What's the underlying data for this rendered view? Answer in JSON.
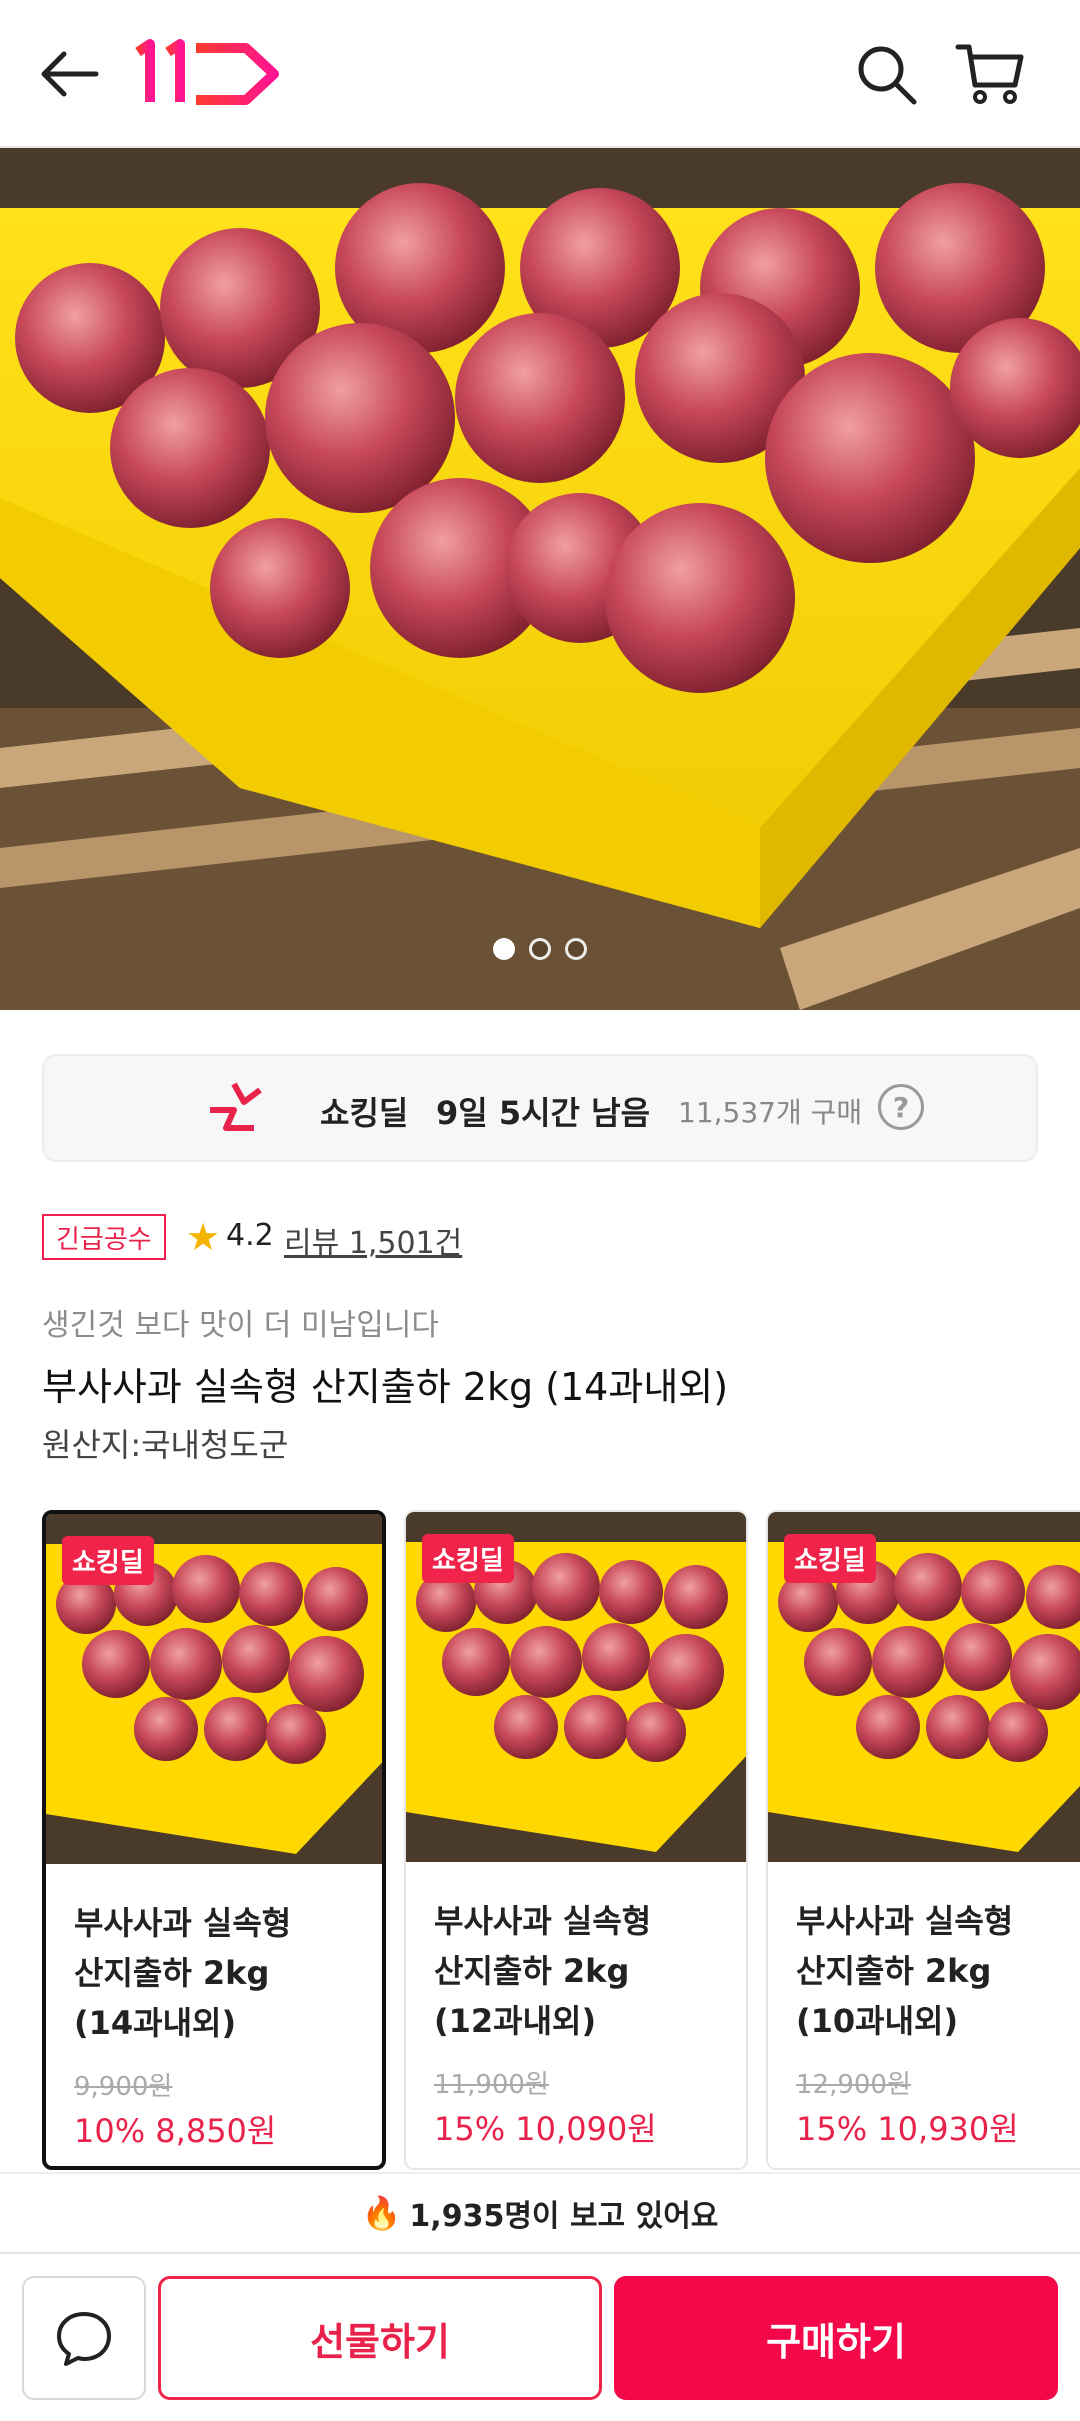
{
  "header": {
    "logo_text": "11",
    "brand_color": "#f0224d"
  },
  "hero": {
    "slide_count": 3,
    "active_slide": 1
  },
  "deal": {
    "brand": "쇼킹딜",
    "time_left": "9일 5시간 남음",
    "purchase_count": "11,537개 구매",
    "help": "?"
  },
  "badge": "긴급공수",
  "rating": {
    "star": "★",
    "value": "4.2",
    "review_label": "리뷰 1,501건"
  },
  "product": {
    "subtitle": "생긴것 보다 맛이 더 미남입니다",
    "title": "부사사과 실속형 산지출하 2kg (14과내외)",
    "origin": "원산지:국내청도군"
  },
  "options": [
    {
      "tag": "쇼킹딜",
      "name_lines": [
        "부사사과 실속형",
        "산지출하 2kg",
        "(14과내외)"
      ],
      "original_price": "9,900원",
      "price": "10% 8,850원",
      "selected": true
    },
    {
      "tag": "쇼킹딜",
      "name_lines": [
        "부사사과 실속형",
        "산지출하 2kg",
        "(12과내외)"
      ],
      "original_price": "11,900원",
      "price": "15% 10,090원",
      "selected": false
    },
    {
      "tag": "쇼킹딜",
      "name_lines": [
        "부사사과 실속형",
        "산지출하 2kg",
        "(10과내외)"
      ],
      "original_price": "12,900원",
      "price": "15% 10,930원",
      "selected": false
    }
  ],
  "viewers": {
    "icon": "🔥",
    "text": "1,935명이 보고 있어요"
  },
  "bottom": {
    "gift_label": "선물하기",
    "buy_label": "구매하기"
  }
}
